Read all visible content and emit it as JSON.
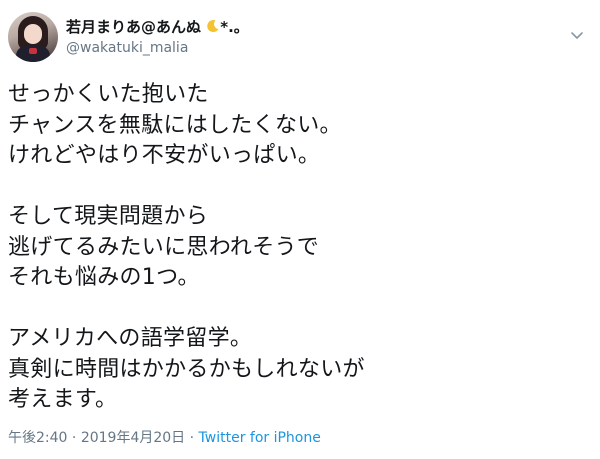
{
  "user": {
    "display_name": "若月まりあ@あんぬ",
    "name_decoration": "*.。",
    "username": "@wakatuki_malia"
  },
  "icons": {
    "moon": "crescent-moon-icon",
    "menu": "chevron-down-icon",
    "avatar": "profile-photo"
  },
  "tweet": {
    "paragraphs": [
      [
        "せっかくいた抱いた",
        "チャンスを無駄にはしたくない。",
        "けれどやはり不安がいっぱい。"
      ],
      [
        "そして現実問題から",
        "逃げてるみたいに思われそうで",
        "それも悩みの1つ。"
      ],
      [
        "アメリカへの語学留学。",
        "真剣に時間はかかるかもしれないが",
        "考えます。"
      ]
    ]
  },
  "meta": {
    "time": "午後2:40",
    "separator": "·",
    "date": "2019年4月20日",
    "source": "Twitter for iPhone"
  },
  "colors": {
    "text": "#14171a",
    "secondary": "#657786",
    "link": "#1b95e0",
    "moon": "#f4c430"
  }
}
